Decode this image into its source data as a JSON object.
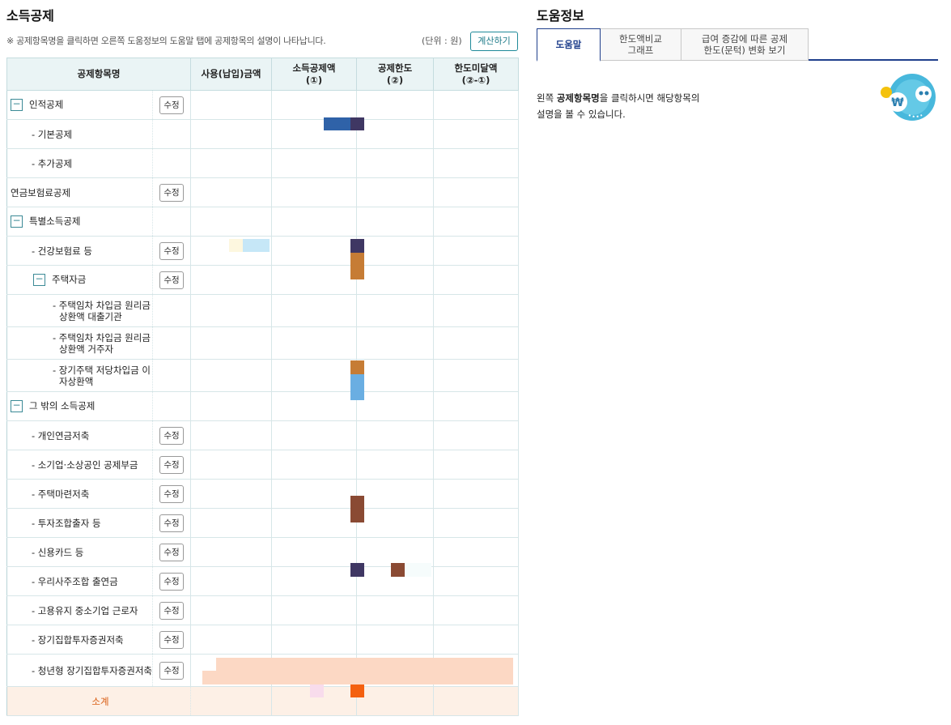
{
  "left": {
    "title": "소득공제",
    "notice": "※ 공제항목명을 클릭하면 오른쪽 도움정보의 도움말 탭에 공제항목의 설명이 나타납니다.",
    "unit": "(단위 : 원)",
    "calc_button": "계산하기",
    "headers": {
      "item": "공제항목명",
      "usage": "사용(납입)금액",
      "deduction": "소득공제액\n(①)",
      "limit": "공제한도\n(②)",
      "remaining": "한도미달액\n(②-①)"
    },
    "edit_label": "수정",
    "toggle_symbol": "−",
    "rows": [
      {
        "label": "인적공제"
      },
      {
        "label": "- 기본공제"
      },
      {
        "label": "- 추가공제"
      },
      {
        "label": "연금보험료공제"
      },
      {
        "label": "특별소득공제"
      },
      {
        "label": "- 건강보험료 등"
      },
      {
        "label": "주택자금"
      },
      {
        "label": "- 주택임차 차입금 원리금상환액 대출기관"
      },
      {
        "label": "- 주택임차 차입금 원리금상환액 거주자"
      },
      {
        "label": "- 장기주택 저당차입금 이자상환액"
      },
      {
        "label": "그 밖의 소득공제"
      },
      {
        "label": "- 개인연금저축"
      },
      {
        "label": "- 소기업·소상공인 공제부금"
      },
      {
        "label": "- 주택마련저축"
      },
      {
        "label": "- 투자조합출자 등"
      },
      {
        "label": "- 신용카드 등"
      },
      {
        "label": "- 우리사주조합 출연금"
      },
      {
        "label": "- 고용유지 중소기업 근로자"
      },
      {
        "label": "- 장기집합투자증권저축"
      },
      {
        "label": "- 청년형 장기집합투자증권저축"
      }
    ],
    "subtotal": "소계"
  },
  "right": {
    "title": "도움정보",
    "tabs": [
      "도움말",
      "한도액비교\n그래프",
      "급여 증감에 따른 공제\n한도(문턱) 변화 보기"
    ],
    "help_prefix": "왼쪽 ",
    "help_bold": "공제항목명",
    "help_suffix": "을 클릭하시면 해당항목의",
    "help_line2": "설명을 볼 수 있습니다.",
    "mascot_icon": "won-coin-mascot-icon"
  },
  "colors": {
    "accent": "#1f3f8c",
    "teal": "#1f8a99",
    "header_bg": "#eaf4f5",
    "subtotal_text": "#d95d13",
    "subtotal_bg": "#fdf0e6"
  }
}
